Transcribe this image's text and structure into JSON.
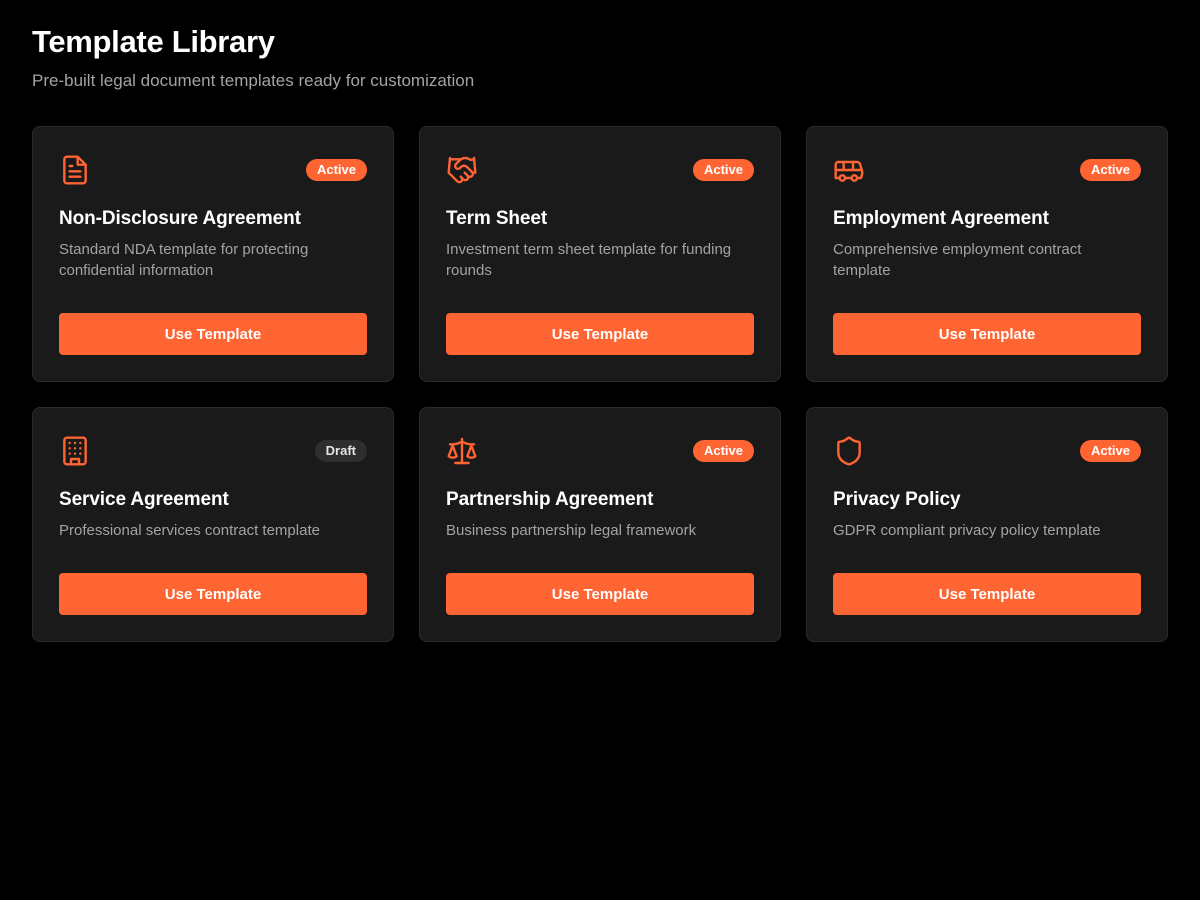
{
  "header": {
    "title": "Template Library",
    "subtitle": "Pre-built legal document templates ready for customization"
  },
  "colors": {
    "accent": "#ff6433",
    "background": "#000000",
    "card": "#1a1a1a",
    "draft_badge": "#2e2e2e"
  },
  "templates": [
    {
      "icon": "document-icon",
      "status": "Active",
      "title": "Non-Disclosure Agreement",
      "description": "Standard NDA template for protecting confidential information",
      "button_label": "Use Template"
    },
    {
      "icon": "handshake-icon",
      "status": "Active",
      "title": "Term Sheet",
      "description": "Investment term sheet template for funding rounds",
      "button_label": "Use Template"
    },
    {
      "icon": "bus-icon",
      "status": "Active",
      "title": "Employment Agreement",
      "description": "Comprehensive employment contract template",
      "button_label": "Use Template"
    },
    {
      "icon": "building-icon",
      "status": "Draft",
      "title": "Service Agreement",
      "description": "Professional services contract template",
      "button_label": "Use Template"
    },
    {
      "icon": "scale-icon",
      "status": "Active",
      "title": "Partnership Agreement",
      "description": "Business partnership legal framework",
      "button_label": "Use Template"
    },
    {
      "icon": "shield-icon",
      "status": "Active",
      "title": "Privacy Policy",
      "description": "GDPR compliant privacy policy template",
      "button_label": "Use Template"
    }
  ]
}
